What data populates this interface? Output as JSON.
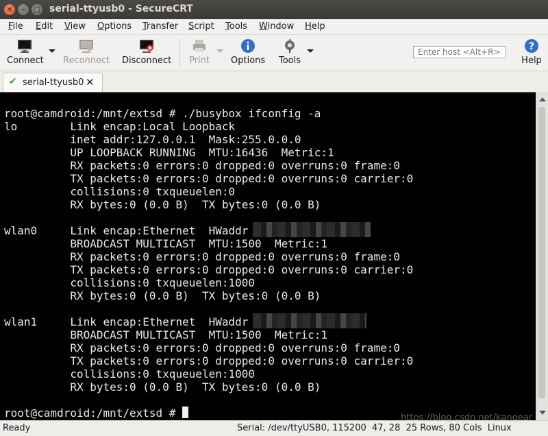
{
  "window": {
    "title": "serial-ttyusb0 - SecureCRT"
  },
  "menu": [
    {
      "label": "File",
      "mnemonic": "F",
      "rest": "ile"
    },
    {
      "label": "Edit",
      "mnemonic": "E",
      "rest": "dit"
    },
    {
      "label": "View",
      "mnemonic": "V",
      "rest": "iew"
    },
    {
      "label": "Options",
      "mnemonic": "O",
      "rest": "ptions"
    },
    {
      "label": "Transfer",
      "mnemonic": "T",
      "rest": "ransfer"
    },
    {
      "label": "Script",
      "mnemonic": "S",
      "rest": "cript"
    },
    {
      "label": "Tools",
      "mnemonic": "T",
      "rest": "ools"
    },
    {
      "label": "Window",
      "mnemonic": "W",
      "rest": "indow"
    },
    {
      "label": "Help",
      "mnemonic": "H",
      "rest": "elp"
    }
  ],
  "toolbar": {
    "connect": "Connect",
    "reconnect": "Reconnect",
    "disconnect": "Disconnect",
    "print": "Print",
    "options": "Options",
    "tools": "Tools",
    "help": "Help",
    "host_placeholder": "Enter host <Alt+R>"
  },
  "tab": {
    "label": "serial-ttyusb0"
  },
  "terminal": {
    "lines": [
      "root@camdroid:/mnt/extsd # ./busybox ifconfig -a",
      "lo        Link encap:Local Loopback",
      "          inet addr:127.0.0.1  Mask:255.0.0.0",
      "          UP LOOPBACK RUNNING  MTU:16436  Metric:1",
      "          RX packets:0 errors:0 dropped:0 overruns:0 frame:0",
      "          TX packets:0 errors:0 dropped:0 overruns:0 carrier:0",
      "          collisions:0 txqueuelen:0",
      "          RX bytes:0 (0.0 B)  TX bytes:0 (0.0 B)",
      "",
      "wlan0     Link encap:Ethernet  HWaddr",
      "          BROADCAST MULTICAST  MTU:1500  Metric:1",
      "          RX packets:0 errors:0 dropped:0 overruns:0 frame:0",
      "          TX packets:0 errors:0 dropped:0 overruns:0 carrier:0",
      "          collisions:0 txqueuelen:1000",
      "          RX bytes:0 (0.0 B)  TX bytes:0 (0.0 B)",
      "",
      "wlan1     Link encap:Ethernet  HWaddr",
      "          BROADCAST MULTICAST  MTU:1500  Metric:1",
      "          RX packets:0 errors:0 dropped:0 overruns:0 frame:0",
      "          TX packets:0 errors:0 dropped:0 overruns:0 carrier:0",
      "          collisions:0 txqueuelen:1000",
      "          RX bytes:0 (0.0 B)  TX bytes:0 (0.0 B)",
      "",
      "root@camdroid:/mnt/extsd # "
    ]
  },
  "status": {
    "left": "Ready",
    "right": "Serial: /dev/ttyUSB0, 115200  47, 28  25 Rows, 80 Cols  Linux"
  },
  "watermark": "https://blog.csdn.net/kangear",
  "colors": {
    "terminal_bg": "#000000",
    "terminal_fg": "#eaeaea",
    "titlebar": "#3b3a36",
    "close_button": "#e0502b"
  }
}
